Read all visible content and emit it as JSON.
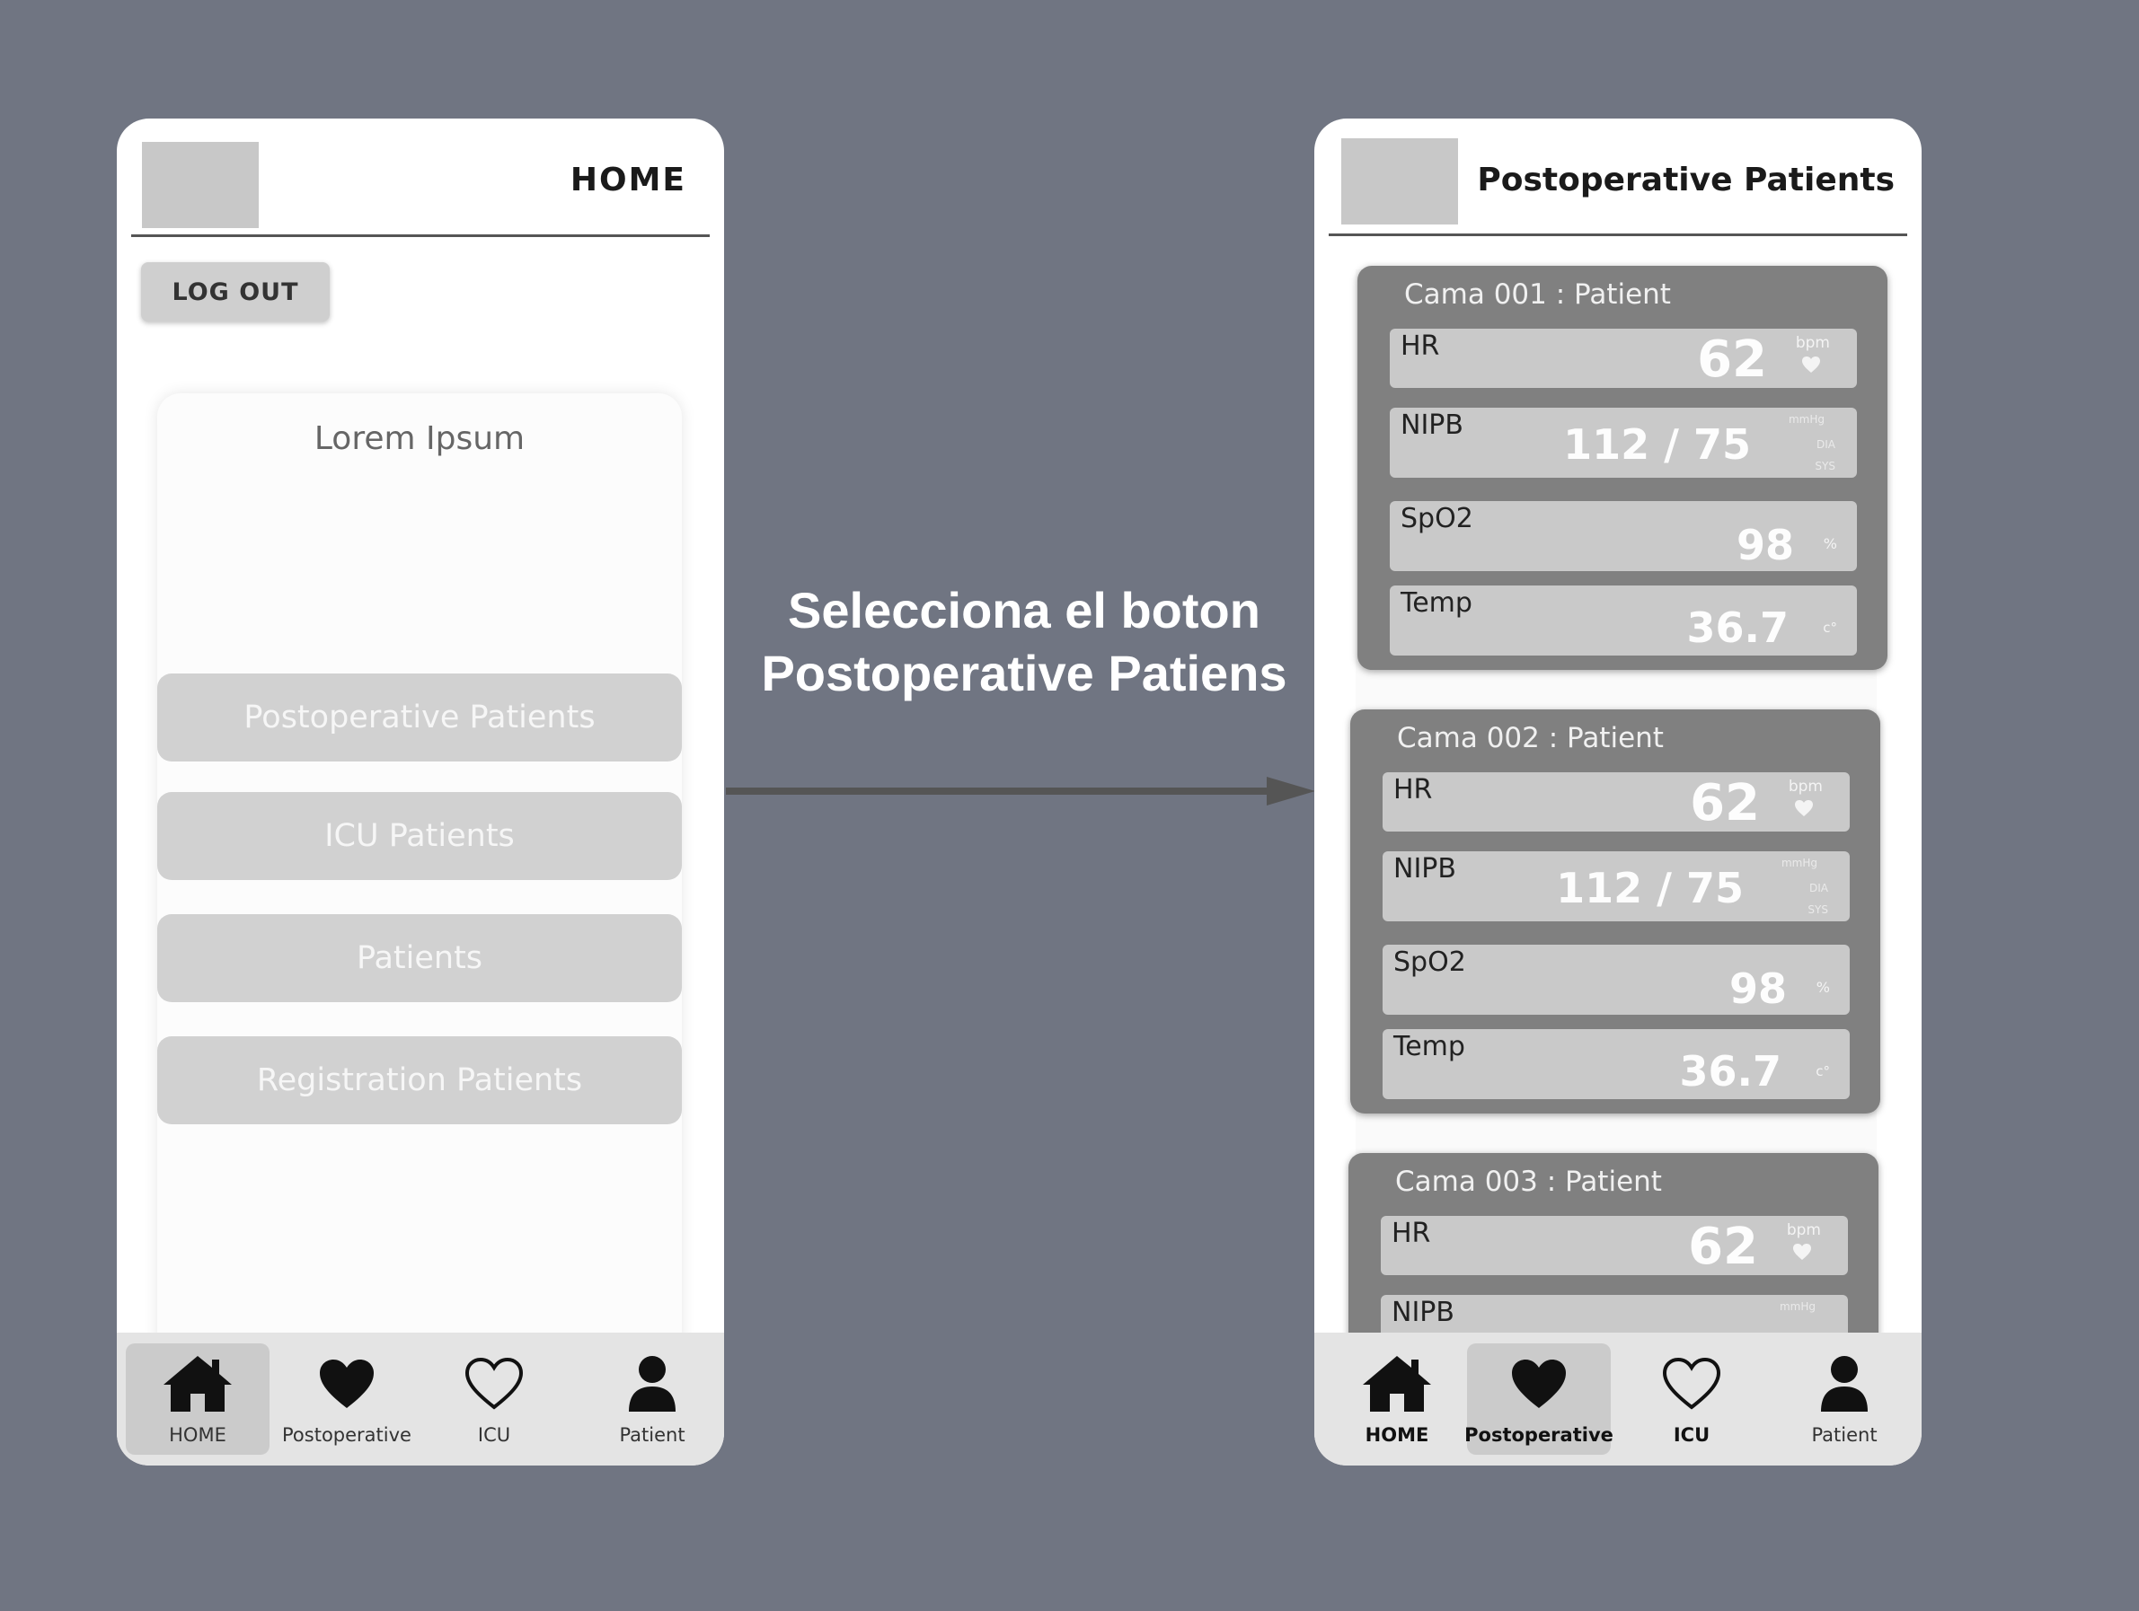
{
  "annotation": {
    "line1": "Selecciona el boton",
    "line2": "Postoperative Patiens"
  },
  "left_screen": {
    "header_title": "HOME",
    "logout_label": "LOG OUT",
    "card_title": "Lorem Ipsum",
    "menu": [
      {
        "label": "Postoperative Patients"
      },
      {
        "label": "ICU Patients"
      },
      {
        "label": "Patients"
      },
      {
        "label": "Registration Patients"
      }
    ]
  },
  "right_screen": {
    "header_title": "Postoperative Patients",
    "cards": [
      {
        "title": "Cama 001 : Patient",
        "hr_label": "HR",
        "hr_value": "62",
        "hr_unit": "bpm",
        "nipb_label": "NIPB",
        "nipb_value": "112 / 75",
        "nipb_unit": "mmHg",
        "nipb_dia": "DIA",
        "nipb_sys": "SYS",
        "spo2_label": "SpO2",
        "spo2_value": "98",
        "spo2_unit": "%",
        "temp_label": "Temp",
        "temp_value": "36.7",
        "temp_unit": "c°"
      },
      {
        "title": "Cama 002 : Patient",
        "hr_label": "HR",
        "hr_value": "62",
        "hr_unit": "bpm",
        "nipb_label": "NIPB",
        "nipb_value": "112 / 75",
        "nipb_unit": "mmHg",
        "nipb_dia": "DIA",
        "nipb_sys": "SYS",
        "spo2_label": "SpO2",
        "spo2_value": "98",
        "spo2_unit": "%",
        "temp_label": "Temp",
        "temp_value": "36.7",
        "temp_unit": "c°"
      },
      {
        "title": "Cama 003 : Patient",
        "hr_label": "HR",
        "hr_value": "62",
        "hr_unit": "bpm",
        "nipb_label": "NIPB",
        "nipb_unit": "mmHg"
      }
    ]
  },
  "nav": [
    {
      "label": "HOME",
      "icon": "home-icon"
    },
    {
      "label": "Postoperative",
      "icon": "heart-filled-icon"
    },
    {
      "label": "ICU",
      "icon": "heart-outline-icon"
    },
    {
      "label": "Patient",
      "icon": "person-icon"
    }
  ],
  "colors": {
    "background": "#707582",
    "button_gray": "#d1d1d1",
    "card_gray": "#808080",
    "vital_gray": "#c9c9c9"
  }
}
